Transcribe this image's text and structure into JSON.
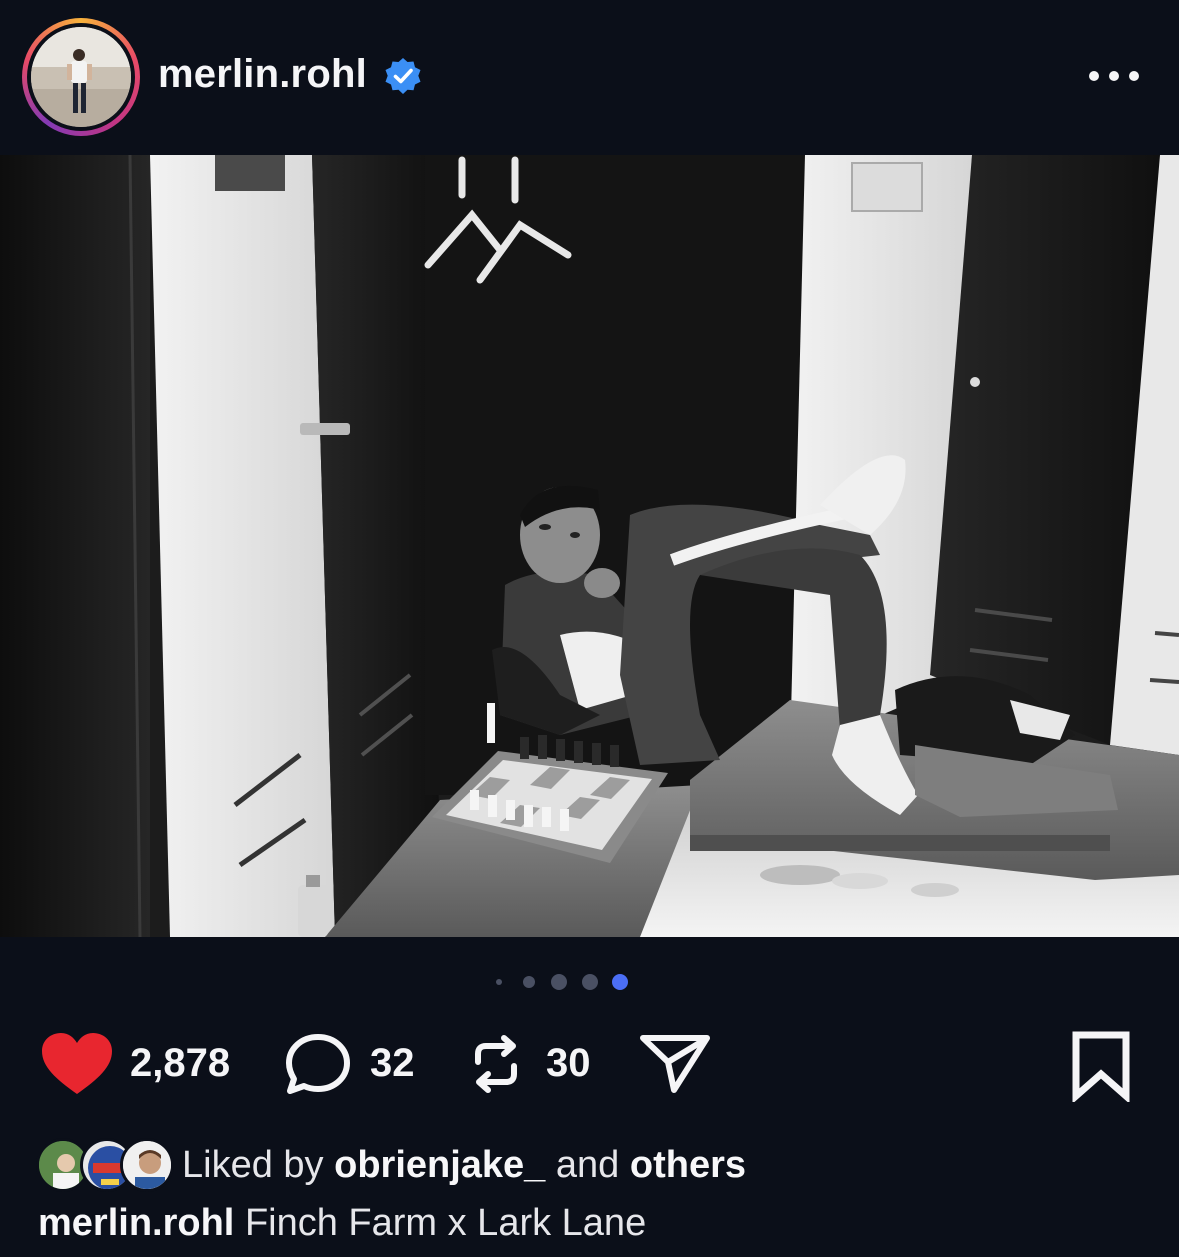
{
  "post": {
    "username": "merlin.rohl",
    "verified": true,
    "more_icon": "more-horizontal-icon",
    "image_description": "",
    "carousel": {
      "total": 5,
      "active_index": 4
    },
    "actions": {
      "likes": "2,878",
      "comments": "32",
      "reposts": "30",
      "like_icon": "heart-filled-icon",
      "comment_icon": "comment-bubble-icon",
      "repost_icon": "repost-icon",
      "share_icon": "send-icon",
      "save_icon": "bookmark-icon"
    },
    "liked_by": {
      "prefix": "Liked by",
      "user": "obrienjake_",
      "joiner": "and",
      "others": "others"
    },
    "caption": {
      "username": "merlin.rohl",
      "text": "Finch Farm x Lark Lane"
    }
  },
  "colors": {
    "background": "#0b0f19",
    "text": "#f5f5f7",
    "like_red": "#e8262f",
    "verified_blue": "#3b8ff5",
    "active_dot": "#4b6ef5",
    "inactive_dot": "#4a5063"
  }
}
